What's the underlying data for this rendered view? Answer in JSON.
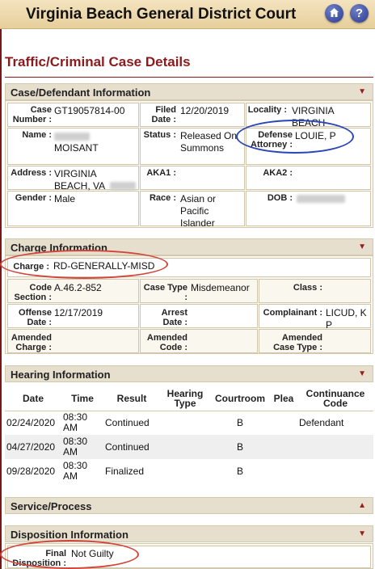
{
  "header": {
    "title": "Virginia Beach General District Court",
    "home_icon": "home-icon",
    "help_label": "?"
  },
  "page_title": "Traffic/Criminal Case Details",
  "case_defendant": {
    "section_title": "Case/Defendant Information",
    "case_number_label": "Case Number :",
    "case_number": "GT19057814-00",
    "filed_date_label": "Filed Date :",
    "filed_date": "12/20/2019",
    "locality_label": "Locality :",
    "locality": "VIRGINIA BEACH",
    "name_label": "Name :",
    "name_surname": "MOISANT",
    "status_label": "Status :",
    "status": "Released On Summons",
    "defense_attorney_label": "Defense Attorney :",
    "defense_attorney": "LOUIE, P",
    "address_label": "Address :",
    "address": "VIRGINIA BEACH, VA",
    "aka1_label": "AKA1 :",
    "aka2_label": "AKA2 :",
    "gender_label": "Gender :",
    "gender": "Male",
    "race_label": "Race :",
    "race": "Asian or Pacific Islander",
    "dob_label": "DOB :"
  },
  "charge": {
    "section_title": "Charge Information",
    "charge_label": "Charge :",
    "charge": "RD-GENERALLY-MISD",
    "code_section_label": "Code Section :",
    "code_section": "A.46.2-852",
    "case_type_label": "Case Type :",
    "case_type": "Misdemeanor",
    "class_label": "Class :",
    "offense_date_label": "Offense Date :",
    "offense_date": "12/17/2019",
    "arrest_date_label": "Arrest Date :",
    "complainant_label": "Complainant :",
    "complainant": "LICUD, K P",
    "amended_charge_label": "Amended Charge :",
    "amended_code_label": "Amended Code :",
    "amended_case_type_label": "Amended Case Type :"
  },
  "hearing": {
    "section_title": "Hearing Information",
    "columns": [
      "Date",
      "Time",
      "Result",
      "Hearing Type",
      "Courtroom",
      "Plea",
      "Continuance Code"
    ],
    "rows": [
      {
        "date": "02/24/2020",
        "time": "08:30 AM",
        "result": "Continued",
        "type": "",
        "courtroom": "B",
        "plea": "",
        "continuance": "Defendant"
      },
      {
        "date": "04/27/2020",
        "time": "08:30 AM",
        "result": "Continued",
        "type": "",
        "courtroom": "B",
        "plea": "",
        "continuance": ""
      },
      {
        "date": "09/28/2020",
        "time": "08:30 AM",
        "result": "Finalized",
        "type": "",
        "courtroom": "B",
        "plea": "",
        "continuance": ""
      }
    ]
  },
  "service": {
    "section_title": "Service/Process"
  },
  "disposition": {
    "section_title": "Disposition Information",
    "final_disposition_label": "Final Disposition :",
    "final_disposition": "Not Guilty"
  },
  "colors": {
    "accent": "#8b1a1d",
    "header_bg": "#e6cf9b",
    "highlight_red": "#d2453a",
    "highlight_blue": "#2b46b5"
  }
}
